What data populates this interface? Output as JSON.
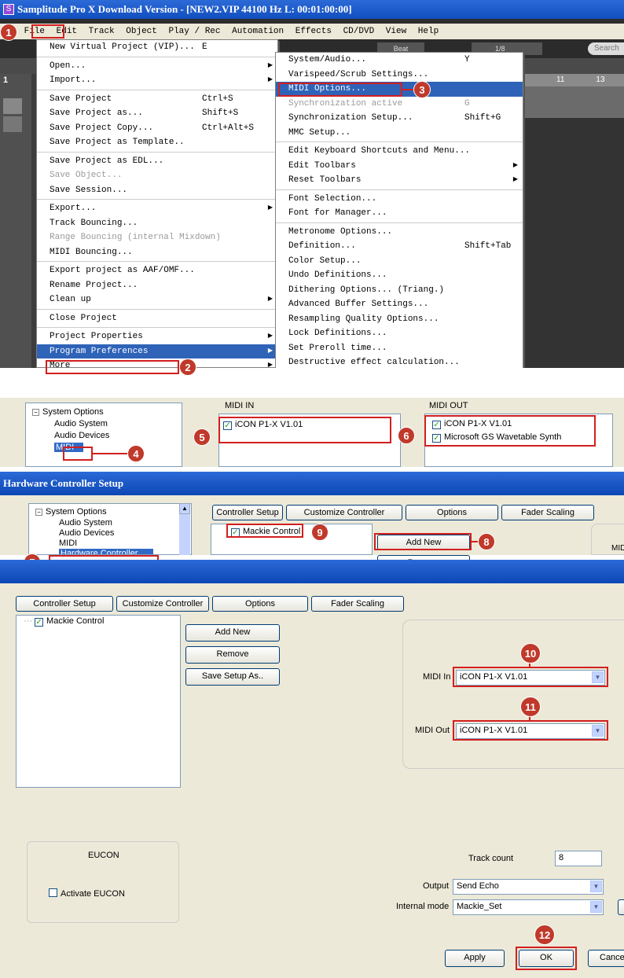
{
  "title_bar": {
    "text": "Samplitude Pro X Download Version - [NEW2.VIP   44100 Hz L: 00:01:00:00]",
    "app_icon": "S"
  },
  "menu_bar": {
    "items": [
      "File",
      "Edit",
      "Track",
      "Object",
      "Play / Rec",
      "Automation",
      "Effects",
      "CD/DVD",
      "View",
      "Help"
    ]
  },
  "toolbar": {
    "search_placeholder": "Search",
    "beat_label": "Beat",
    "grid_value": "1/8",
    "ruler": [
      "11",
      "13"
    ],
    "track_number": "1"
  },
  "file_menu": [
    {
      "label": "New Virtual Project (VIP)...",
      "shortcut": "E"
    },
    {
      "sep": true
    },
    {
      "label": "Open...",
      "sub": true
    },
    {
      "label": "Import...",
      "sub": true
    },
    {
      "sep": true
    },
    {
      "label": "Save Project",
      "shortcut": "Ctrl+S"
    },
    {
      "label": "Save Project as...",
      "shortcut": "Shift+S"
    },
    {
      "label": "Save Project Copy...",
      "shortcut": "Ctrl+Alt+S"
    },
    {
      "label": "Save Project as Template.."
    },
    {
      "sep": true
    },
    {
      "label": "Save Project as EDL..."
    },
    {
      "label": "Save Object...",
      "disabled": true
    },
    {
      "label": "Save Session..."
    },
    {
      "sep": true
    },
    {
      "label": "Export...",
      "sub": true
    },
    {
      "label": "Track Bouncing..."
    },
    {
      "label": "Range Bouncing (internal Mixdown)",
      "disabled": true
    },
    {
      "label": "MIDI Bouncing..."
    },
    {
      "sep": true
    },
    {
      "label": "Export project as AAF/OMF..."
    },
    {
      "label": "Rename Project..."
    },
    {
      "label": "Clean up",
      "sub": true
    },
    {
      "sep": true
    },
    {
      "label": "Close Project"
    },
    {
      "sep": true
    },
    {
      "label": "Project Properties",
      "sub": true
    },
    {
      "label": "Program Preferences",
      "sub": true,
      "highlight": true
    },
    {
      "label": "More",
      "sub": true
    }
  ],
  "prefs_menu": [
    {
      "label": "System/Audio...",
      "shortcut": "Y"
    },
    {
      "label": "Varispeed/Scrub Settings..."
    },
    {
      "label": "MIDI Options...",
      "highlight": true
    },
    {
      "label": "Synchronization active",
      "shortcut": "G",
      "disabled": true
    },
    {
      "label": "Synchronization Setup...",
      "shortcut": "Shift+G"
    },
    {
      "label": "MMC Setup..."
    },
    {
      "sep": true
    },
    {
      "label": "Edit Keyboard Shortcuts and Menu..."
    },
    {
      "label": "Edit Toolbars",
      "sub": true
    },
    {
      "label": "Reset Toolbars",
      "sub": true
    },
    {
      "sep": true
    },
    {
      "label": "Font Selection..."
    },
    {
      "label": "Font for Manager..."
    },
    {
      "sep": true
    },
    {
      "label": "Metronome Options..."
    },
    {
      "label": "Definition...",
      "shortcut": "Shift+Tab"
    },
    {
      "label": "Color Setup..."
    },
    {
      "label": "Undo Definitions..."
    },
    {
      "label": "Dithering Options... (Triang.)"
    },
    {
      "label": "Advanced Buffer Settings..."
    },
    {
      "label": "Resampling Quality Options..."
    },
    {
      "label": "Lock Definitions..."
    },
    {
      "label": "Set Preroll time..."
    },
    {
      "label": "Destructive effect calculation..."
    }
  ],
  "midi_panel": {
    "tree": [
      "System Options",
      "Audio System",
      "Audio Devices",
      "MIDI"
    ],
    "midi_in_label": "MIDI IN",
    "midi_out_label": "MIDI OUT",
    "midi_in_devices": [
      "iCON P1-X V1.01"
    ],
    "midi_out_devices": [
      "iCON P1-X V1.01",
      "Microsoft GS Wavetable Synth"
    ]
  },
  "hw_panel": {
    "title": "Hardware Controller Setup",
    "tree": [
      "System Options",
      "Audio System",
      "Audio Devices",
      "MIDI",
      "Hardware Controller"
    ],
    "tabs": [
      "Controller Setup",
      "Customize Controller",
      "Options",
      "Fader Scaling"
    ],
    "controller": "Mackie Control",
    "add_new": "Add New",
    "remove": "Remove",
    "partial_label": "MID"
  },
  "setup_panel": {
    "tabs": [
      "Controller Setup",
      "Customize Controller",
      "Options",
      "Fader Scaling"
    ],
    "controller": "Mackie Control",
    "add_new": "Add New",
    "remove": "Remove",
    "save_setup": "Save Setup As..",
    "midi_in_label": "MIDI In",
    "midi_in_value": "iCON P1-X V1.01",
    "midi_out_label": "MIDI Out",
    "midi_out_value": "iCON P1-X V1.01",
    "eucon_title": "EUCON",
    "activate_eucon": "Activate EUCON",
    "track_count_label": "Track count",
    "track_count_value": "8",
    "output_label": "Output",
    "output_value": "Send Echo",
    "internal_mode_label": "Internal mode",
    "internal_mode_value": "Mackie_Set",
    "apply": "Apply",
    "ok": "OK",
    "cancel": "Cance"
  },
  "callouts": [
    "1",
    "2",
    "3",
    "4",
    "5",
    "6",
    "7",
    "8",
    "9",
    "10",
    "11",
    "12"
  ],
  "colors": {
    "callout": "#c0392b",
    "highlight": "#2e63b8",
    "title_bar": "#1c5cc8"
  }
}
